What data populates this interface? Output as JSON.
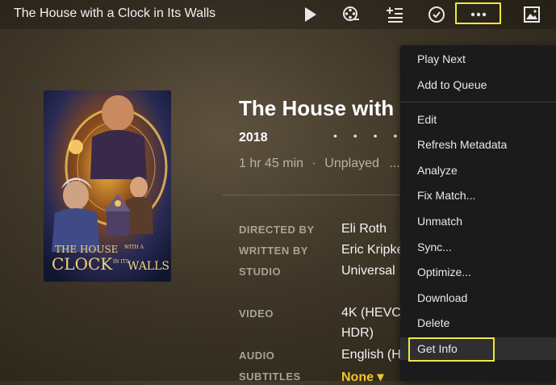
{
  "header": {
    "title": "The House with a Clock in Its Walls",
    "icons": [
      "play-icon",
      "film-reel-icon",
      "add-to-playlist-icon",
      "checkmark-icon",
      "more-icon",
      "image-icon"
    ]
  },
  "details": {
    "title": "The House with",
    "year": "2018",
    "rating_dots": "• • • • • • •",
    "duration": "1 hr 45 min",
    "separator": "·",
    "status": "Unplayed",
    "status_more": "...",
    "directed_by_label": "DIRECTED BY",
    "directed_by": "Eli Roth",
    "written_by_label": "WRITTEN BY",
    "written_by": "Eric Kripke",
    "studio_label": "STUDIO",
    "studio": "Universal",
    "video_label": "VIDEO",
    "video_line1": "4K (HEVC",
    "video_line2": "HDR)",
    "audio_label": "AUDIO",
    "audio": "English (H",
    "subtitles_label": "SUBTITLES",
    "subtitles": "None ▾"
  },
  "poster": {
    "line1": "THE HOUSE",
    "line1_small": "WITH A",
    "line2": "CLOCK",
    "line2_small": "IN ITS",
    "line3": "WALLS"
  },
  "menu": {
    "group1": [
      "Play Next",
      "Add to Queue"
    ],
    "group2": [
      "Edit",
      "Refresh Metadata",
      "Analyze",
      "Fix Match...",
      "Unmatch",
      "Sync...",
      "Optimize...",
      "Download",
      "Delete",
      "Get Info"
    ]
  },
  "colors": {
    "highlight": "#f1e83a",
    "subtitles_accent": "#f3c629",
    "menu_bg": "#1b1b1c"
  }
}
